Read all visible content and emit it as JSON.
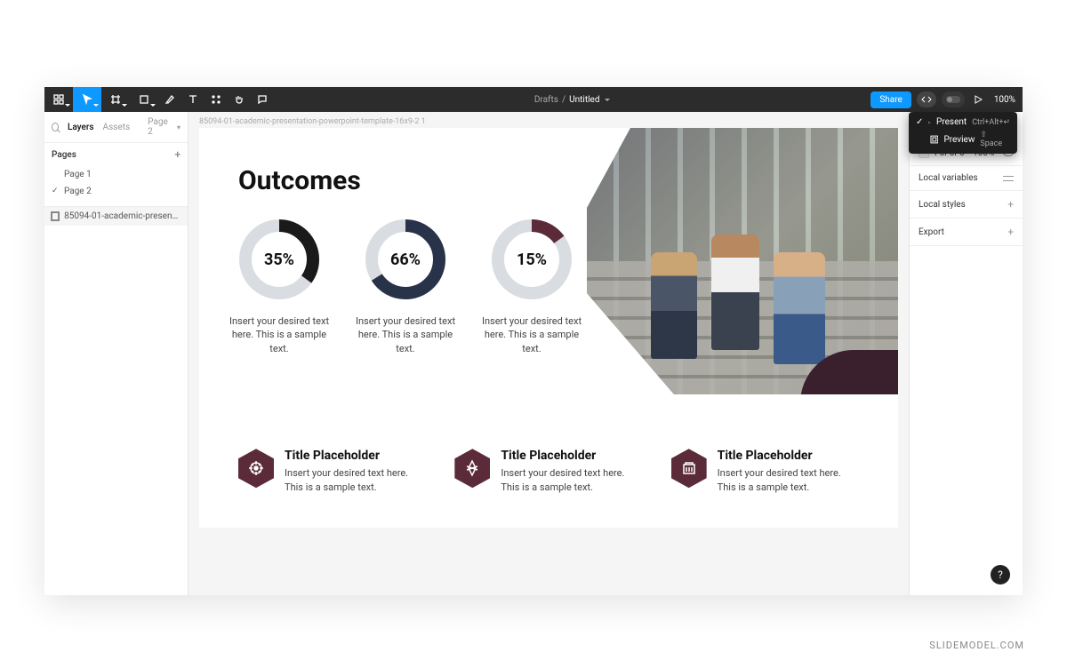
{
  "toolbar": {
    "breadcrumb_folder": "Drafts",
    "breadcrumb_sep": "/",
    "file_name": "Untitled",
    "share_label": "Share",
    "zoom": "100%"
  },
  "present_menu": {
    "present_label": "Present",
    "present_shortcut": "Ctrl+Alt+↵",
    "preview_label": "Preview",
    "preview_shortcut": "⇧ Space"
  },
  "left_panel": {
    "tab_layers": "Layers",
    "tab_assets": "Assets",
    "page_indicator": "Page 2",
    "pages_header": "Pages",
    "page1": "Page 1",
    "page2": "Page 2",
    "layer_name": "85094-01-academic-presentatio..."
  },
  "right_panel": {
    "color_hex": "F5F5F5",
    "color_opacity": "100%",
    "local_variables": "Local variables",
    "local_styles": "Local styles",
    "export": "Export"
  },
  "canvas": {
    "frame_label": "85094-01-academic-presentation-powerpoint-template-16x9-2 1",
    "slide": {
      "title": "Outcomes",
      "donuts": [
        {
          "value": 35,
          "label": "35%",
          "text": "Insert your desired text here. This is a sample text.",
          "color": "#1a1a1a"
        },
        {
          "value": 66,
          "label": "66%",
          "text": "Insert your desired text here. This is a sample text.",
          "color": "#283248"
        },
        {
          "value": 15,
          "label": "15%",
          "text": "Insert your desired text here. This is a sample text.",
          "color": "#5c2b3a"
        }
      ],
      "hex_items": [
        {
          "title": "Title Placeholder",
          "text": "Insert your desired text here. This is a sample text."
        },
        {
          "title": "Title Placeholder",
          "text": "Insert your desired text here. This is a sample text."
        },
        {
          "title": "Title Placeholder",
          "text": "Insert your desired text here. This is a sample text."
        }
      ]
    }
  },
  "chart_data": [
    {
      "type": "pie",
      "title": "",
      "values": [
        35,
        65
      ],
      "categories": [
        "filled",
        "remaining"
      ],
      "colors": [
        "#1a1a1a",
        "#d9dde2"
      ]
    },
    {
      "type": "pie",
      "title": "",
      "values": [
        66,
        34
      ],
      "categories": [
        "filled",
        "remaining"
      ],
      "colors": [
        "#283248",
        "#d9dde2"
      ]
    },
    {
      "type": "pie",
      "title": "",
      "values": [
        15,
        85
      ],
      "categories": [
        "filled",
        "remaining"
      ],
      "colors": [
        "#5c2b3a",
        "#d9dde2"
      ]
    }
  ],
  "help_label": "?",
  "watermark": "SLIDEMODEL.COM"
}
